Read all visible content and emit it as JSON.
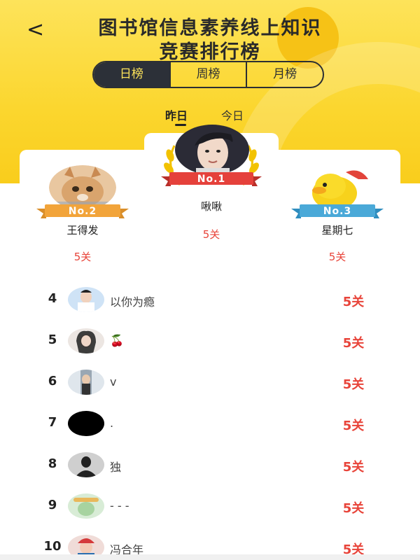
{
  "header": {
    "back_glyph": "<",
    "title_line1": "图书馆信息素养线上知识",
    "title_line2": "竞赛排行榜"
  },
  "period_tabs": [
    {
      "label": "日榜",
      "active": true
    },
    {
      "label": "周榜",
      "active": false
    },
    {
      "label": "月榜",
      "active": false
    }
  ],
  "day_tabs": [
    {
      "label": "昨日",
      "active": true
    },
    {
      "label": "今日",
      "active": false
    }
  ],
  "podium": {
    "first": {
      "badge": "No.1",
      "name": "啾啾",
      "score": "5关"
    },
    "second": {
      "badge": "No.2",
      "name": "王得发",
      "score": "5关"
    },
    "third": {
      "badge": "No.3",
      "name": "星期七",
      "score": "5关"
    }
  },
  "ranking": [
    {
      "rank": "4",
      "name": "以你为瘾",
      "score": "5关"
    },
    {
      "rank": "5",
      "name": "🍒",
      "score": "5关"
    },
    {
      "rank": "6",
      "name": "v",
      "score": "5关"
    },
    {
      "rank": "7",
      "name": ".",
      "score": "5关"
    },
    {
      "rank": "8",
      "name": "独",
      "score": "5关"
    },
    {
      "rank": "9",
      "name": "- - -",
      "score": "5关"
    },
    {
      "rank": "10",
      "name": "冯合年",
      "score": "5关"
    }
  ],
  "colors": {
    "accent_yellow": "#fbd62e",
    "score_red": "#e8443a",
    "no1_ribbon": "#e5413b",
    "no2_ribbon": "#f2a43a",
    "no3_ribbon": "#4aa9d8",
    "dark_tab": "#2c3038"
  }
}
